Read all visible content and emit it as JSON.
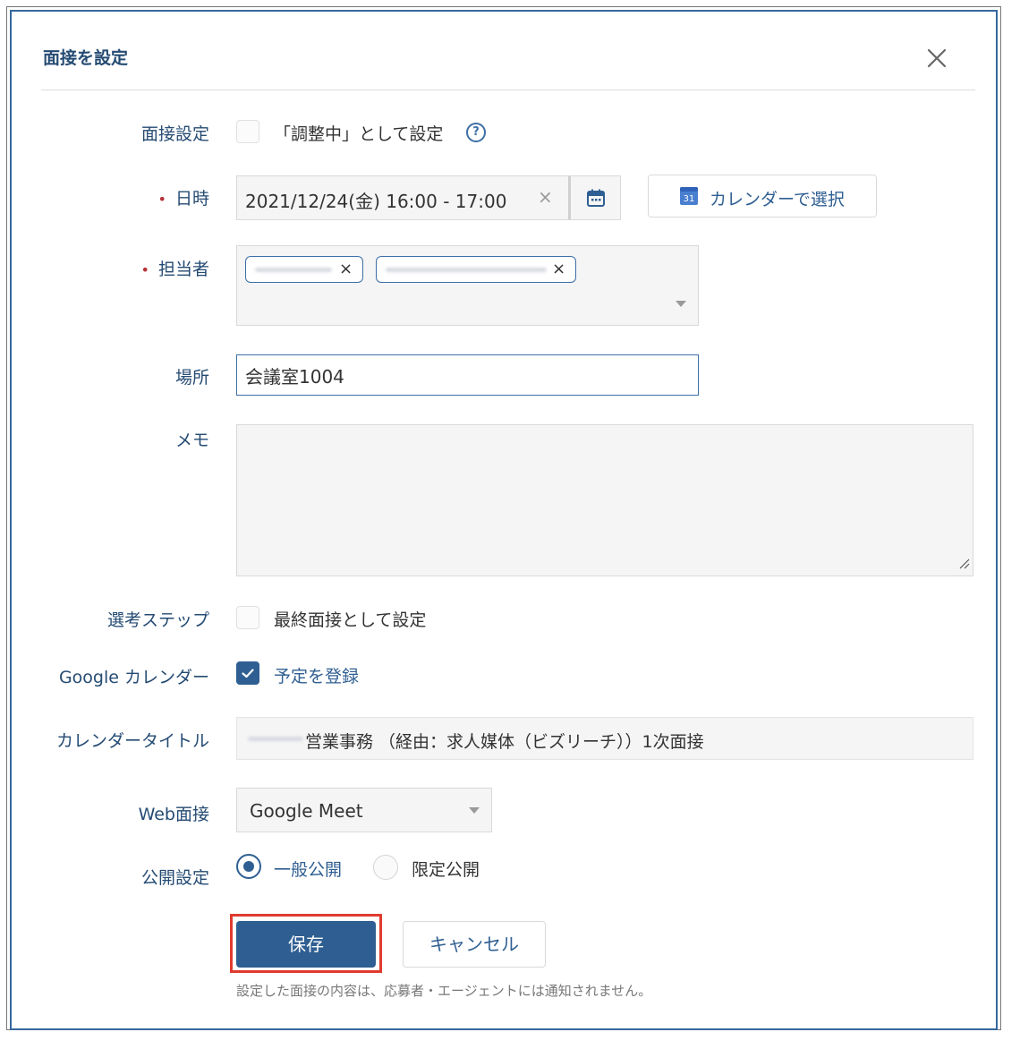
{
  "dialog": {
    "title": "面接を設定"
  },
  "labels": {
    "interview_setting": "面接設定",
    "datetime": "日時",
    "assignee": "担当者",
    "location": "場所",
    "memo": "メモ",
    "selection_step": "選考ステップ",
    "google_calendar": "Google カレンダー",
    "calendar_title": "カレンダータイトル",
    "web_interview": "Web面接",
    "visibility": "公開設定",
    "required_mark": "•"
  },
  "interview_setting": {
    "checkbox_label": "「調整中」として設定",
    "checked": false
  },
  "datetime": {
    "value": "2021/12/24(金) 16:00 - 17:00",
    "clear": "×"
  },
  "calendar_button": {
    "label": "カレンダーで選択",
    "icon_text": "31"
  },
  "assignee": {
    "tag_remove": "×"
  },
  "location": {
    "value": "会議室1004"
  },
  "memo": {
    "value": ""
  },
  "selection_step": {
    "checkbox_label": "最終面接として設定",
    "checked": false
  },
  "google_calendar": {
    "checkbox_label": "予定を登録",
    "checked": true
  },
  "calendar_title": {
    "value": "営業事務 （経由：求人媒体（ビズリーチ））1次面接"
  },
  "web_interview": {
    "selected": "Google Meet"
  },
  "visibility": {
    "option_public": "一般公開",
    "option_limited": "限定公開",
    "selected": "一般公開"
  },
  "actions": {
    "save": "保存",
    "cancel": "キャンセル"
  },
  "note": "設定した面接の内容は、応募者・エージェントには通知されません。",
  "colors": {
    "accent": "#2f5f92",
    "label": "#254b73",
    "required": "#b8323b",
    "highlight": "#e03b2f"
  }
}
